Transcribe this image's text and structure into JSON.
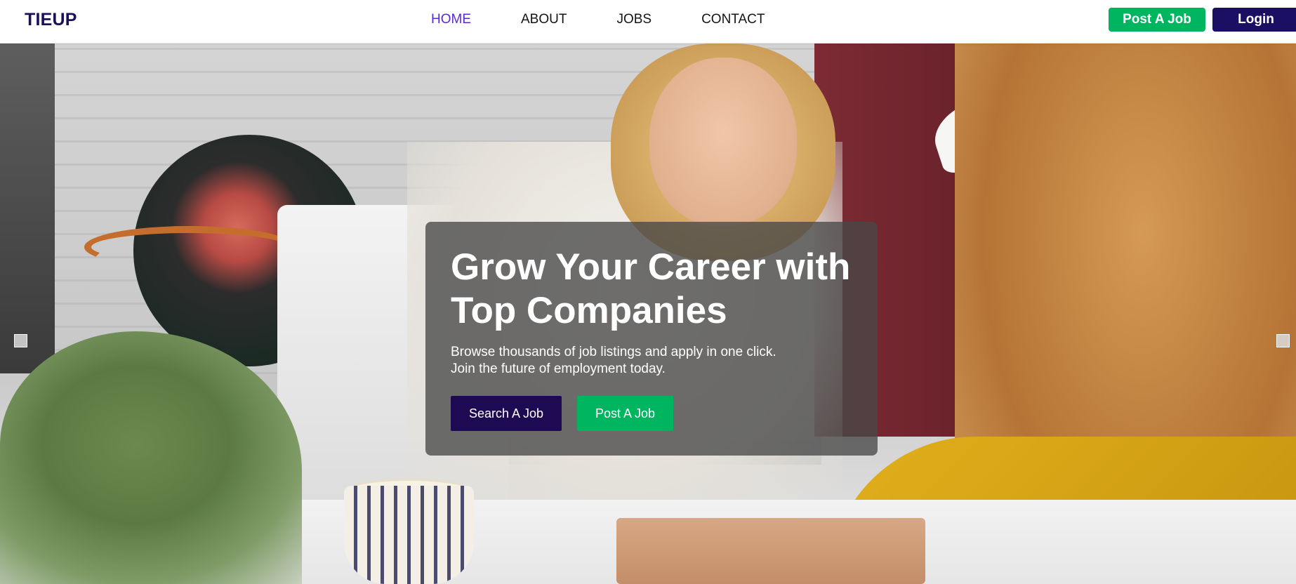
{
  "brand": {
    "logo_text": "TIEUP",
    "primary_color": "#1b0f63",
    "accent_green": "#00b560",
    "active_link_color": "#5a2ad4"
  },
  "nav": {
    "links": [
      {
        "label": "HOME",
        "active": true
      },
      {
        "label": "ABOUT",
        "active": false
      },
      {
        "label": "JOBS",
        "active": false
      },
      {
        "label": "CONTACT",
        "active": false
      }
    ],
    "post_job_label": "Post A Job",
    "login_label": "Login"
  },
  "hero": {
    "title_line1": "Grow Your Career with",
    "title_line2": "Top Companies",
    "subtitle_line1": "Browse thousands of job listings and apply in one click.",
    "subtitle_line2": "Join the future of employment today.",
    "search_button_label": "Search A Job",
    "post_button_label": "Post A Job",
    "background_image": "office handshake photo"
  },
  "carousel": {
    "prev_icon": "square-prev-indicator",
    "next_icon": "square-next-indicator"
  }
}
